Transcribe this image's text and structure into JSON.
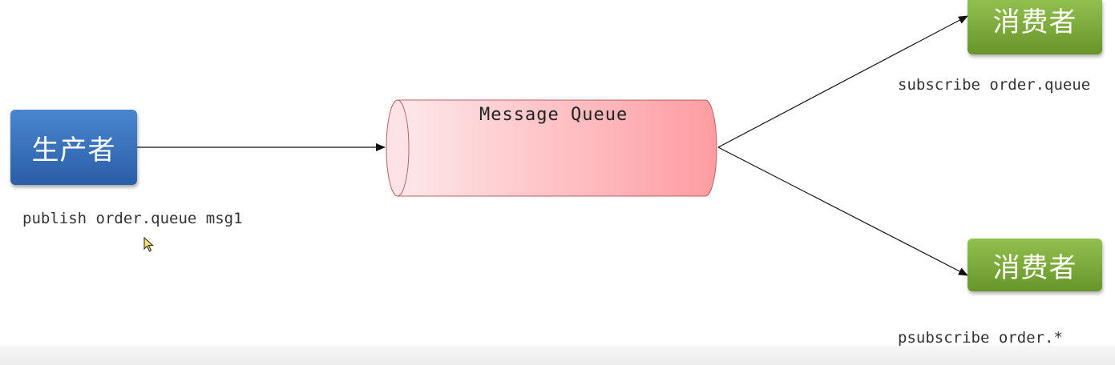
{
  "diagram": {
    "producer": {
      "label": "生产者",
      "command": "publish order.queue msg1"
    },
    "queue": {
      "label": "Message Queue"
    },
    "consumers": [
      {
        "label": "消费者",
        "command": "subscribe order.queue"
      },
      {
        "label": "消费者",
        "command": "psubscribe order.*"
      }
    ]
  },
  "colors": {
    "producer": "#3a72bd",
    "consumer": "#7aa83a",
    "queue_light": "#fde3e6",
    "queue_dark": "#ff9ea3",
    "queue_stroke": "#b14a4a"
  }
}
